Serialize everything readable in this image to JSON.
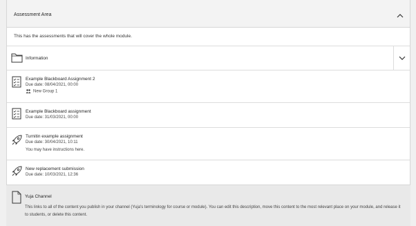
{
  "section": {
    "title": "Assessment Area",
    "description": "This has the assessments that will cover the whole module."
  },
  "folder": {
    "title": "Information",
    "icon": "folder-icon"
  },
  "items": [
    {
      "title": "Example Blackboard Assignment 2",
      "due": "Due date: 08/04/2021, 00:00",
      "group": "New Group 1",
      "icon": "assignment-icon"
    },
    {
      "title": "Example Blackboard assignment",
      "due": "Due date: 31/03/2021, 00:00",
      "icon": "assignment-icon"
    },
    {
      "title": "Turnitin example assignment",
      "due": "Due date: 30/04/2021, 10:11",
      "note": "You may have instructions here.",
      "icon": "rocket-icon"
    },
    {
      "title": "New replacement submission",
      "due": "Due date: 10/03/2021, 12:36",
      "icon": "rocket-icon"
    }
  ],
  "yuja": {
    "title": "Yuja Channel",
    "description": "This links to all of the content you publish in your channel (Yuja's terminology for course or module). You can edit this description, move this content to the most relevant place on your module, and release it to students, or delete this content.",
    "icon": "document-icon"
  }
}
